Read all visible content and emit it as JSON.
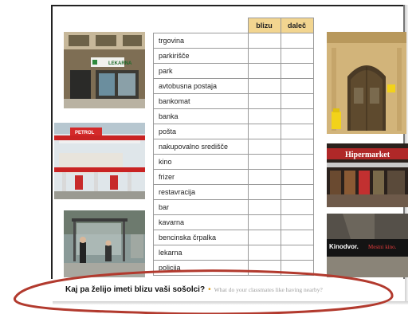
{
  "table": {
    "headers": [
      "blizu",
      "daleč"
    ],
    "places": [
      "trgovina",
      "parkirišče",
      "park",
      "avtobusna postaja",
      "bankomat",
      "banka",
      "pošta",
      "nakupovalno središče",
      "kino",
      "frizer",
      "restavracija",
      "bar",
      "kavarna",
      "bencinska črpalka",
      "lekarna",
      "policija"
    ]
  },
  "photos": {
    "lekarna_sign": "LEKARNA",
    "petrol_sign": "PETROL",
    "hiper_sign": "Hipermarket",
    "kino_sign_main": "Kinodvor.",
    "kino_sign_sub": "Mestni kino."
  },
  "question": {
    "slovene": "Kaj pa želijo imeti blizu vaši sošolci?",
    "separator": "•",
    "english": "What do your classmates like having nearby?"
  },
  "colors": {
    "header_fill": "#f2d590",
    "ellipse": "#b23a2e",
    "accent_dot": "#e0a020"
  }
}
